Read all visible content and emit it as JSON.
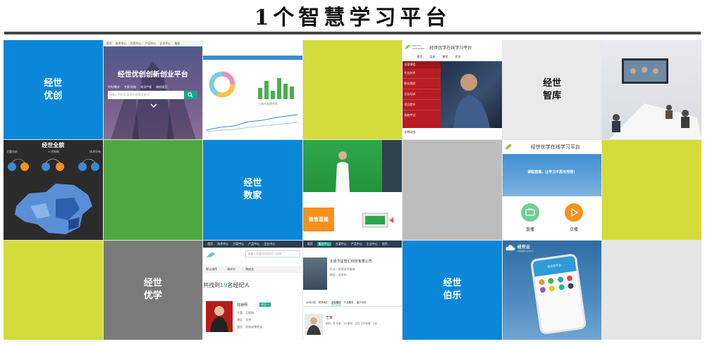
{
  "title": "1个智慧学习平台",
  "tiles": {
    "r1c1": {
      "line1": "经世",
      "line2": "优创"
    },
    "r1c2": {
      "nav": [
        "首页",
        "技术中心",
        "方案中心",
        "产品中心",
        "企业中心",
        "服务"
      ],
      "hero_title": "经世优创创新创业平台",
      "search_tabs": [
        "专利/需求",
        "专家/机构",
        "知识产权",
        "政府项目"
      ],
      "search_placeholder": "请输入专利号/发明名称等关键词"
    },
    "r1c3": {
      "chart_label": "三年内发明专利"
    },
    "r1c5": {
      "org": "JINGSHI ZHIHUIJING",
      "header_title": "经世优学在线学习平台",
      "tabs": [
        "首页",
        "培训",
        "课程",
        "资讯"
      ],
      "menu_header": "全部课程",
      "menu": [
        "专业技术",
        "职业素质",
        "企业培训",
        "学历提升",
        "技能考试"
      ],
      "footer_label": "长期动态"
    },
    "r1c6": {
      "line1": "经世",
      "line2": "智库"
    },
    "r2c1": {
      "header": "经世全貌",
      "labels": [
        "主题分析",
        "人才结构",
        "技术分布"
      ]
    },
    "r2c3": {
      "line1": "经世",
      "line2": "数家"
    },
    "r2c4": {
      "badge": "微信直播"
    },
    "r2c6": {
      "header_title": "经世优学在线学习平台",
      "banner_text": "课程直播，让学习不再无界限！",
      "btn1": "直播",
      "btn2": "点播"
    },
    "r3c2": {
      "line1": "经世",
      "line2": "优学"
    },
    "r3c3": {
      "nav": [
        "首页",
        "技术中心",
        "方案中心",
        "产品中心",
        "企业中心"
      ],
      "search_placeholder": "请输入您要找的经纪人名称",
      "sort": [
        "默认排序",
        "按评分",
        "按成交"
      ],
      "result_prefix": "共找到",
      "result_count": "19",
      "result_suffix": "名经纪人",
      "person_name": "陆裕明",
      "person_badge": "经纪人",
      "person_lines": [
        "主管：互联网",
        "地区：北京",
        "服务：科技成果转化"
      ]
    },
    "r3c4": {
      "nav": [
        "首页",
        "服务中心",
        "方案中心",
        "产品中心",
        "企业中心",
        "信托"
      ],
      "company": "北京华星智汇科技有限公司",
      "company_lines": [
        "行业：信息技术服务",
        "地区：北京市"
      ],
      "tabs": [
        "公司介绍",
        "联系我们",
        "企业展示",
        "产品服务",
        "客户评价"
      ],
      "person": "王家",
      "person_line": "性别：男 年龄：28 职务：主任 工作年限：5年"
    },
    "r3c5": {
      "line1": "经世",
      "line2": "伯乐"
    },
    "r3c6": {
      "cloud_label": "经世云",
      "cloud_sub": "JINGSHI CLOUD",
      "phone_header": "经世云平台"
    }
  },
  "colors": {
    "blue": "#0a87d8",
    "green": "#4ea83f",
    "lime": "#d4dc3b",
    "grey": "#7a7a7a",
    "teal": "#17a589",
    "orange": "#f5921e"
  }
}
